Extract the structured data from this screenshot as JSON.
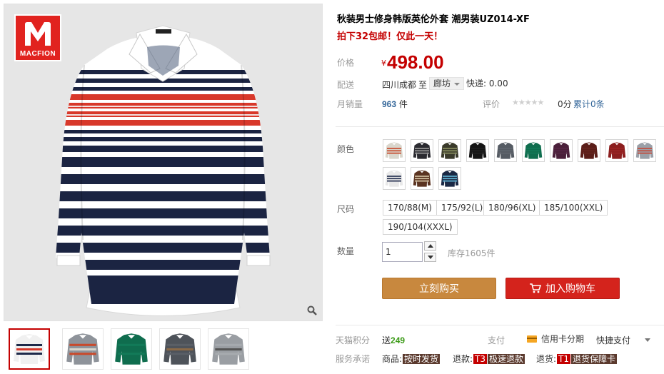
{
  "brand": {
    "name": "MACFION"
  },
  "product": {
    "title": "秋装男士修身韩版英伦外套 潮男装UZ014-XF",
    "subtitle": "拍下32包邮！仅此一天！",
    "price_label": "价格",
    "currency": "¥",
    "price": "498.00",
    "shipping_label": "配送",
    "ship_from": "四川成都",
    "ship_to_word": "至",
    "ship_to": "廊坊",
    "express": "快递: 0.00",
    "sales_label": "月销量",
    "sales_count": "963",
    "sales_unit": "件",
    "review_label": "评价",
    "stars": "★★★★★",
    "score": "0分",
    "review_link": "累计0条"
  },
  "options": {
    "color_label": "颜色",
    "size_label": "尺码",
    "sizes": [
      "170/88(M)",
      "175/92(L)",
      "180/96(XL)",
      "185/100(XXL)",
      "190/104(XXXL)"
    ],
    "qty_label": "数量",
    "qty_value": "1",
    "stock": "库存1605件",
    "swatch_colors": [
      {
        "body": "#d9d6cc",
        "stripe": "#c84a2c"
      },
      {
        "body": "#2a2a30",
        "stripe": "#9a9a9a"
      },
      {
        "body": "#3a3a2a",
        "stripe": "#8a9060"
      },
      {
        "body": "#151515",
        "stripe": "#202020"
      },
      {
        "body": "#555b63",
        "stripe": "#60666e"
      },
      {
        "body": "#0f6d4e",
        "stripe": "#127a58"
      },
      {
        "body": "#4a1f3a",
        "stripe": "#552645"
      },
      {
        "body": "#5a1d18",
        "stripe": "#66241e"
      },
      {
        "body": "#8c1e1e",
        "stripe": "#9c2424"
      },
      {
        "body": "#9aa0a8",
        "stripe": "#c44a3a"
      },
      {
        "body": "#e8e8e8",
        "stripe": "#1e2a4a"
      },
      {
        "body": "#5a3320",
        "stripe": "#d9c9a8"
      },
      {
        "body": "#1a2844",
        "stripe": "#62b8d8"
      }
    ]
  },
  "actions": {
    "buy_now": "立刻购买",
    "add_cart": "加入购物车"
  },
  "footer": {
    "points_label": "天猫积分",
    "points_prefix": "送",
    "points_value": "249",
    "pay_label": "支付",
    "credit": "信用卡分期",
    "quick_pay": "快捷支付",
    "service_label": "服务承诺",
    "svc_goods": "商品:",
    "svc_goods_tag": "按时发货",
    "svc_refund": "退款:",
    "svc_refund_code": "T3",
    "svc_refund_tag": "极速退款",
    "svc_return": "退货:",
    "svc_return_code": "T1",
    "svc_return_tag": "退货保障卡"
  },
  "thumbnails": [
    {
      "body": "#f0f0f0",
      "stripe": "#1e2a4a",
      "accent": "#d6382a"
    },
    {
      "body": "#8e939a",
      "stripe": "#c84a2c",
      "accent": "#d9d6cc"
    },
    {
      "body": "#0f6d4e",
      "stripe": "#127a58",
      "accent": "#0f6d4e"
    },
    {
      "body": "#4e535a",
      "stripe": "#5a5f66",
      "accent": "#8a6a48"
    },
    {
      "body": "#9a9ea3",
      "stripe": "#a6aaaf",
      "accent": "#555"
    }
  ]
}
